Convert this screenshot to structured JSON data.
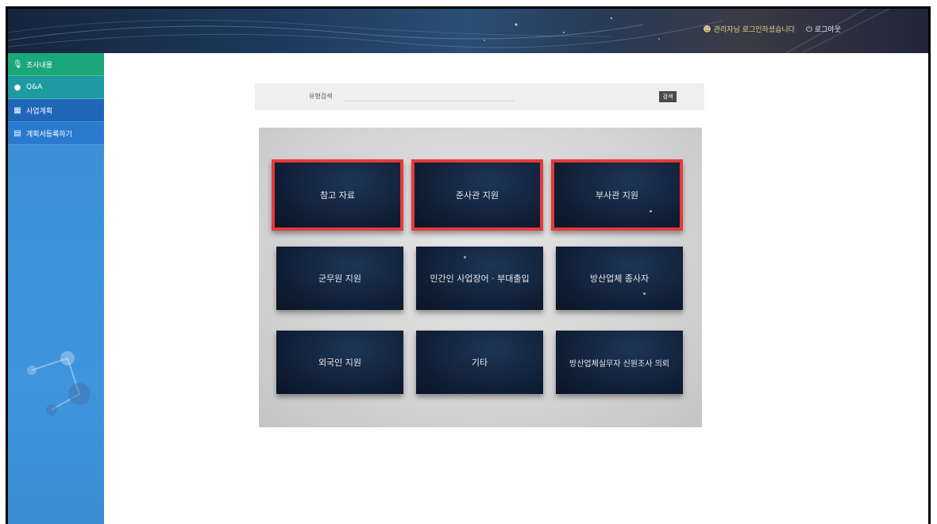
{
  "header": {
    "links": [
      {
        "icon": "user-icon",
        "label": "관리자님 로그인하셨습니다"
      },
      {
        "icon": "power-icon",
        "label": "로그아웃"
      }
    ]
  },
  "sidebar": {
    "items": [
      {
        "icon": "mic-icon",
        "label": "조사내용"
      },
      {
        "icon": "chat-icon",
        "label": "Q&A"
      },
      {
        "icon": "doc-icon",
        "label": "사업계획"
      },
      {
        "icon": "list-icon",
        "label": "계획서등록하기"
      }
    ]
  },
  "search": {
    "label": "유형검색",
    "placeholder": "",
    "value": "",
    "button_label": "검색"
  },
  "tiles": [
    {
      "label": "참고 자료",
      "highlighted": true
    },
    {
      "label": "준사관 지원",
      "highlighted": true
    },
    {
      "label": "부사관 지원",
      "highlighted": true
    },
    {
      "label": "군무원 지원",
      "highlighted": false
    },
    {
      "label": "민간인 사업장어 · 부대출입",
      "highlighted": false
    },
    {
      "label": "방산업체 종사자",
      "highlighted": false
    },
    {
      "label": "외국인 지원",
      "highlighted": false
    },
    {
      "label": "기타",
      "highlighted": false
    },
    {
      "label": "방산업체실무자 신원조사 의뢰",
      "highlighted": false
    }
  ],
  "colors": {
    "highlight_border": "#e53a3a",
    "sidebar_active": "#1aa77a",
    "sidebar_bg": "#3e95dc"
  }
}
